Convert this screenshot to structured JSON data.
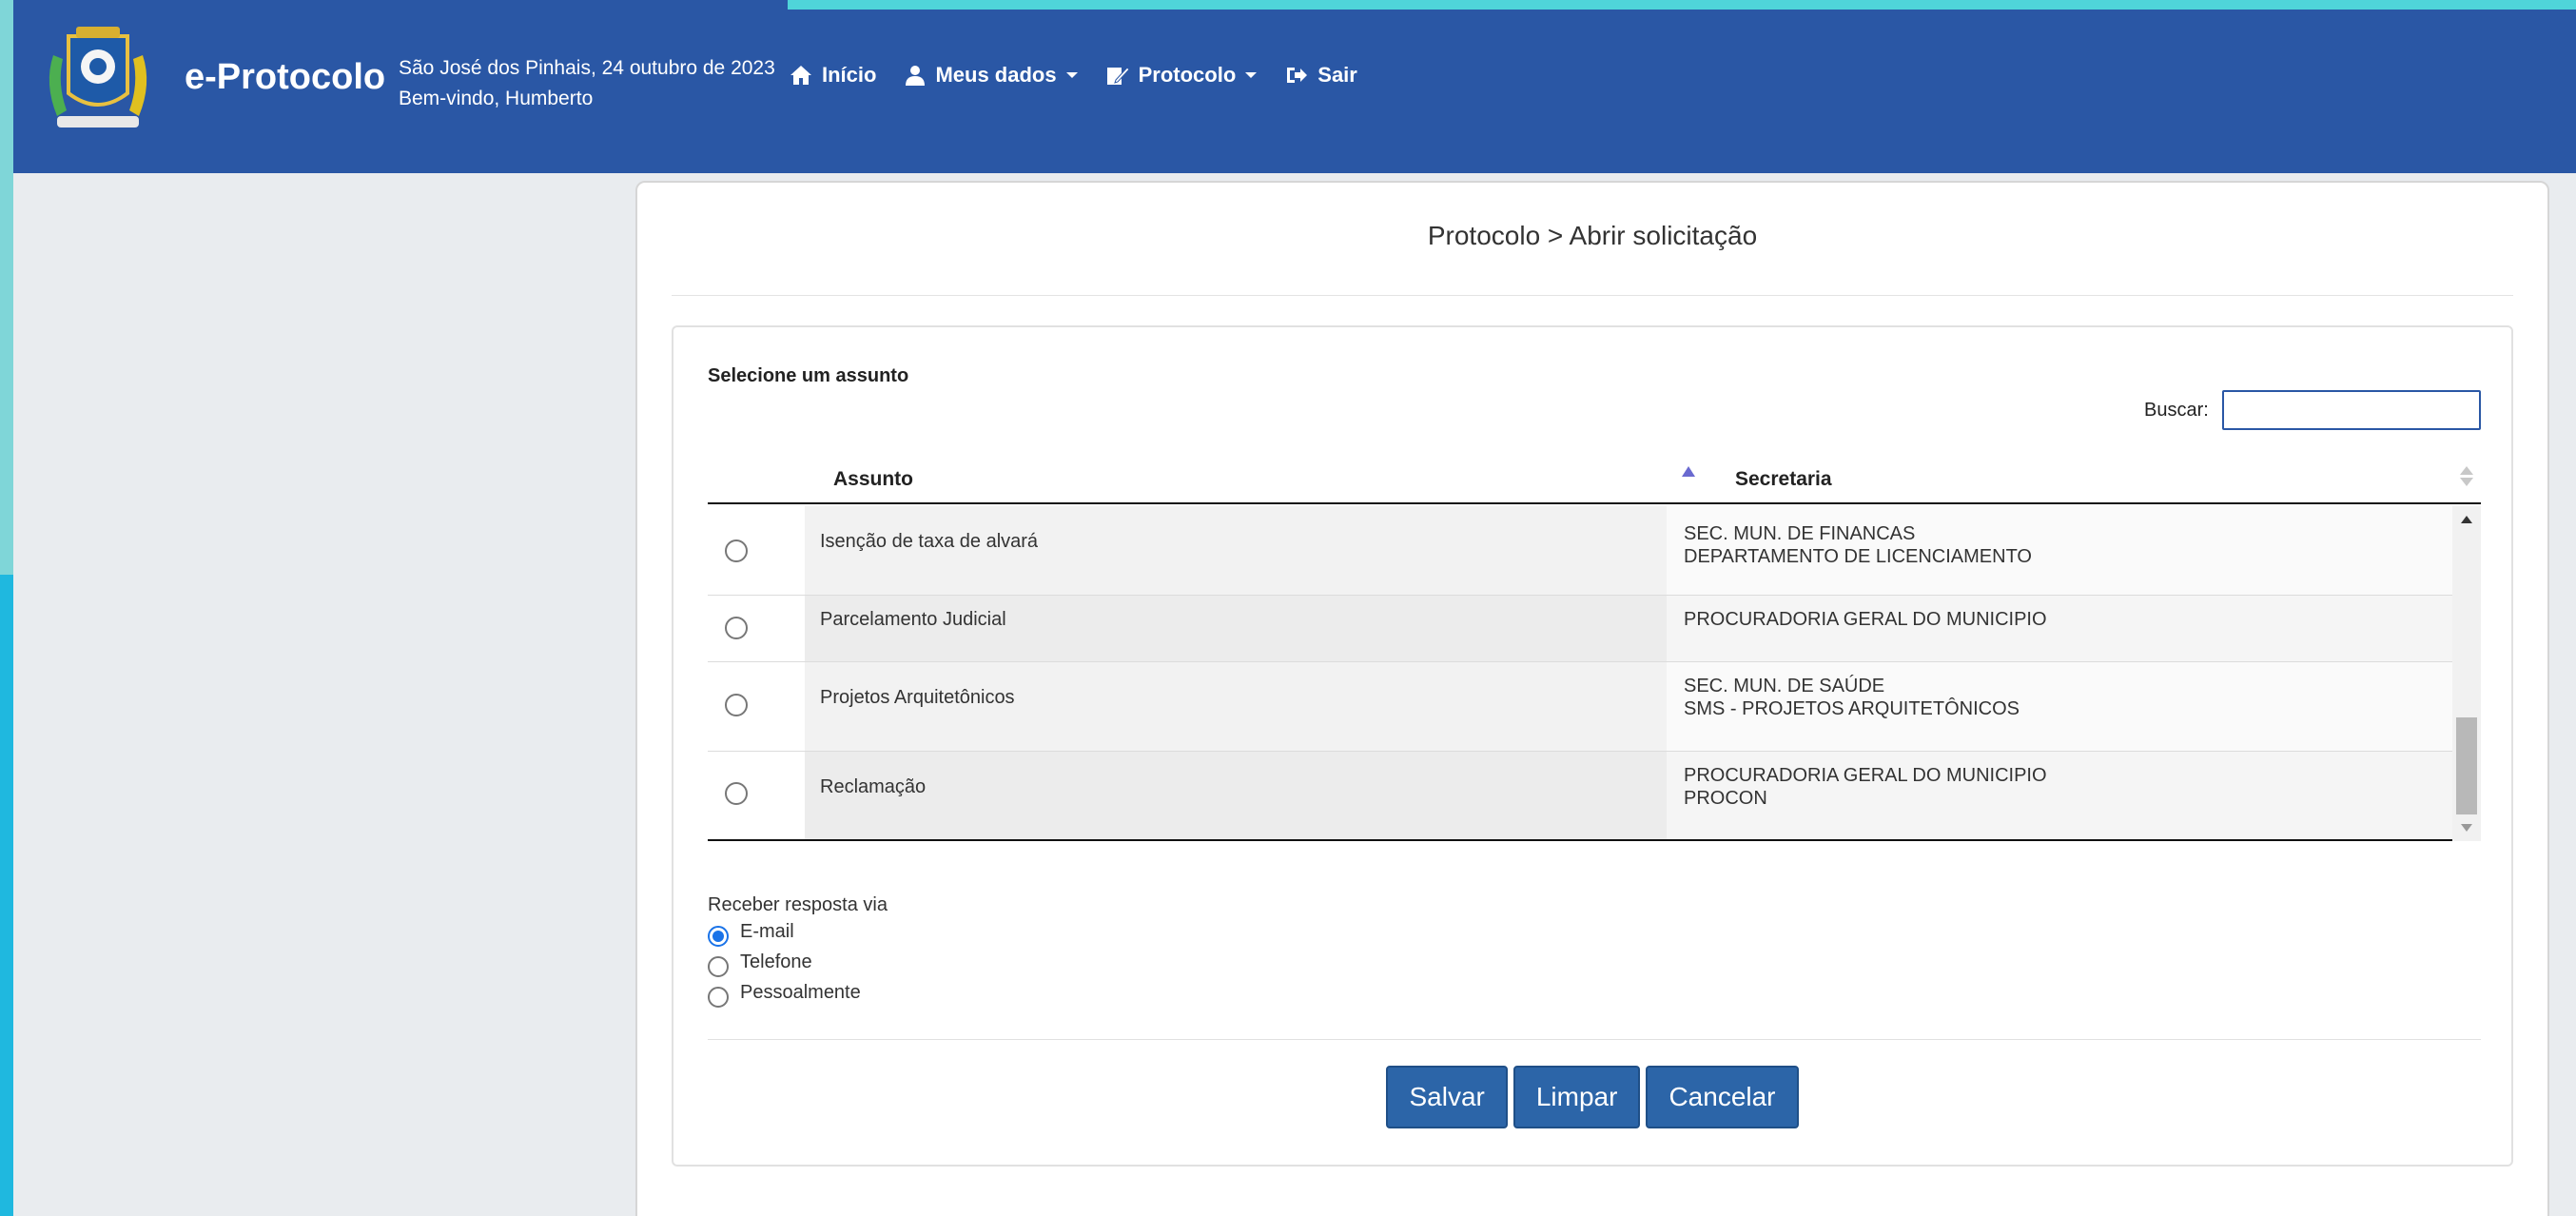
{
  "header": {
    "brand": "e-Protocolo",
    "date_line": "São José dos Pinhais, 24 outubro de 2023",
    "welcome": "Bem-vindo, Humberto",
    "menu": [
      {
        "label": "Início",
        "icon": "home-icon"
      },
      {
        "label": "Meus dados",
        "icon": "user-icon"
      },
      {
        "label": "Protocolo",
        "icon": "edit-icon"
      },
      {
        "label": "Sair",
        "icon": "sign-out-icon"
      }
    ],
    "colors": {
      "navbar": "#2a57a5",
      "accent": "#2c65a8"
    }
  },
  "page": {
    "title": "Protocolo > Abrir solicitação",
    "heading": "Selecione um assunto",
    "search_label": "Buscar:",
    "search_value": ""
  },
  "table": {
    "columns": [
      "Assunto",
      "Secretaria"
    ],
    "sort": {
      "column": "Assunto",
      "direction": "asc"
    },
    "rows": [
      {
        "assunto": "Isenção de taxa de alvará",
        "secretaria": [
          "SEC. MUN. DE FINANCAS",
          "DEPARTAMENTO DE LICENCIAMENTO"
        ]
      },
      {
        "assunto": "Parcelamento Judicial",
        "secretaria": [
          "PROCURADORIA GERAL DO MUNICIPIO"
        ]
      },
      {
        "assunto": "Projetos Arquitetônicos",
        "secretaria": [
          "SEC. MUN. DE SAÚDE",
          "SMS - PROJETOS ARQUITETÔNICOS"
        ]
      },
      {
        "assunto": "Reclamação",
        "secretaria": [
          "PROCURADORIA GERAL DO MUNICIPIO",
          "PROCON"
        ]
      }
    ]
  },
  "response": {
    "label": "Receber resposta via",
    "options": [
      {
        "label": "E-mail",
        "checked": true
      },
      {
        "label": "Telefone",
        "checked": false
      },
      {
        "label": "Pessoalmente",
        "checked": false
      }
    ]
  },
  "buttons": {
    "save": "Salvar",
    "clear": "Limpar",
    "cancel": "Cancelar"
  }
}
